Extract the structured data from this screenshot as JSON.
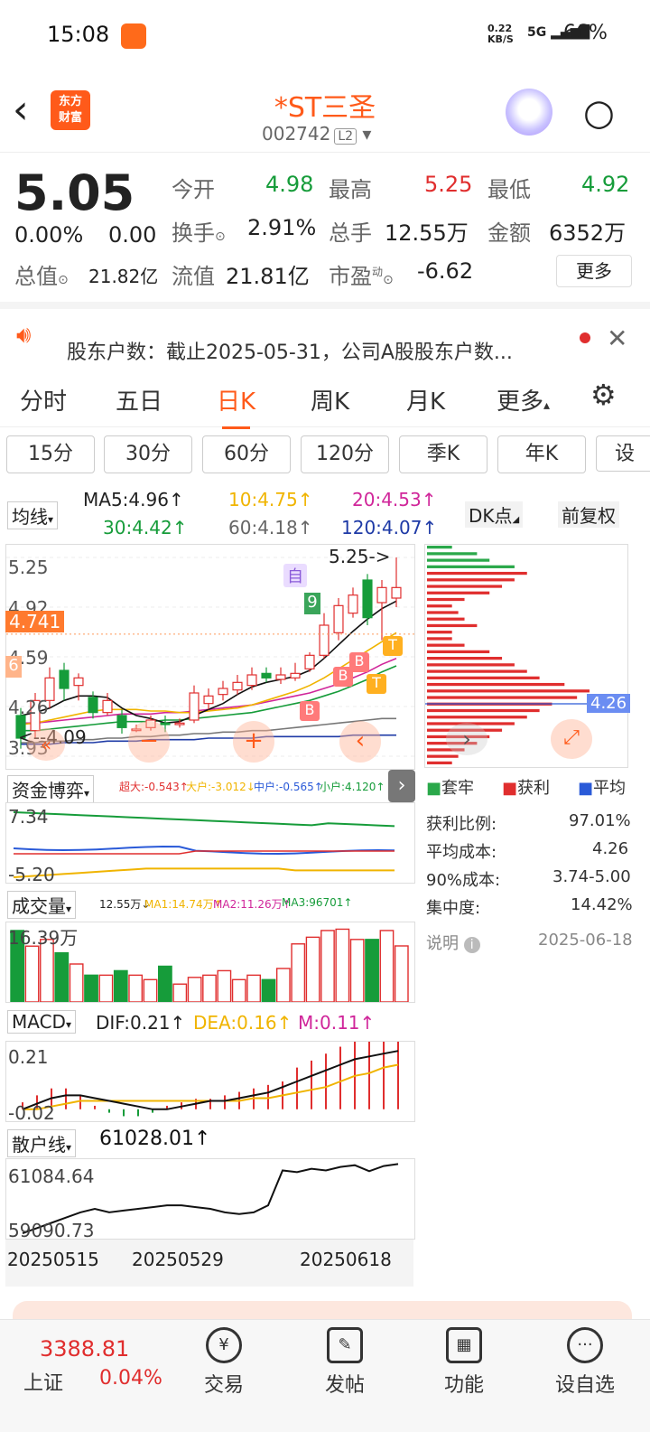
{
  "status": {
    "time": "15:08",
    "net": "0.22\nKB/S",
    "signal": "5G",
    "battery": "66%"
  },
  "header": {
    "brand": "东方\n财富",
    "title": "*ST三圣",
    "code": "002742",
    "level": "L2"
  },
  "quote": {
    "price": "5.05",
    "change_pct": "0.00%",
    "change": "0.00",
    "open_label": "今开",
    "open": "4.98",
    "high_label": "最高",
    "high": "5.25",
    "low_label": "最低",
    "low": "4.92",
    "turnover_label": "换手",
    "turnover": "2.91%",
    "volume_label": "总手",
    "volume": "12.55万",
    "amount_label": "金额",
    "amount": "6352万",
    "mktcap_label": "总值",
    "mktcap": "21.82亿",
    "float_label": "流值",
    "float": "21.81亿",
    "pe_label": "市盈",
    "pe_sup": "动",
    "pe": "-6.62",
    "more": "更多"
  },
  "notice": {
    "text": "股东户数：截止2025-05-31，公司A股股东户数..."
  },
  "tabs": [
    "分时",
    "五日",
    "日K",
    "周K",
    "月K",
    "更多"
  ],
  "subtabs": [
    "15分",
    "30分",
    "60分",
    "120分",
    "季K",
    "年K",
    "设"
  ],
  "ma": {
    "label": "均线",
    "ma5": "MA5:4.96",
    "ma10": "10:4.75",
    "ma20": "20:4.53",
    "ma30": "30:4.42",
    "ma60": "60:4.18",
    "ma120": "120:4.07",
    "dk": "DK点",
    "fq": "前复权"
  },
  "kchart": {
    "ymax": "5.25",
    "y2": "4.92",
    "ylast": "4.741",
    "y3": "4.59",
    "y4": "4.26",
    "ymin": "3.93",
    "high_marker": "5.25->",
    "low_marker": "<--4.09",
    "mark_self": "自",
    "mark_b": "B",
    "mark_t": "T",
    "mark_6": "6",
    "mark_9": "9"
  },
  "fund": {
    "label": "资金博弈",
    "super": "超大:-0.543",
    "big": "大户:-3.012",
    "mid": "中户:-0.565",
    "small": "小户:4.120",
    "ytop": "7.34",
    "ybot": "-5.20"
  },
  "vol": {
    "label": "成交量",
    "v": "12.55万",
    "ma1": "MA1:14.74万",
    "ma2": "MA2:11.26万",
    "ma3": "MA3:96701",
    "ytop": "16.39万"
  },
  "macd": {
    "label": "MACD",
    "dif": "DIF:0.21",
    "dea": "DEA:0.16",
    "m": "M:0.11",
    "ytop": "0.21",
    "ybot": "-0.02"
  },
  "sanhu": {
    "label": "散户线",
    "value": "61028.01",
    "ytop": "61084.64",
    "ybot": "59090.73"
  },
  "dates": [
    "20250515",
    "20250529",
    "20250618"
  ],
  "chip": {
    "legend_trapped": "套牢",
    "legend_profit": "获利",
    "legend_avg": "平均",
    "profit_ratio_label": "获利比例:",
    "profit_ratio": "97.01%",
    "avg_cost_label": "平均成本:",
    "avg_cost": "4.26",
    "cost90_label": "90%成本:",
    "cost90": "3.74-5.00",
    "conc_label": "集中度:",
    "conc": "14.42%",
    "explain": "说明",
    "date": "2025-06-18",
    "price_tag": "4.26"
  },
  "bottom": {
    "index_value": "3388.81",
    "index_name": "上证",
    "index_pct": "0.04%",
    "trade": "交易",
    "post": "发帖",
    "func": "功能",
    "custom": "设自选"
  },
  "chart_data": {
    "type": "candlestick",
    "title": "",
    "ylim": [
      3.93,
      5.25
    ],
    "candles": [
      {
        "o": 4.2,
        "c": 4.05,
        "h": 4.25,
        "l": 3.98
      },
      {
        "o": 4.1,
        "c": 4.3,
        "h": 4.35,
        "l": 4.05
      },
      {
        "o": 4.3,
        "c": 4.45,
        "h": 4.52,
        "l": 4.25
      },
      {
        "o": 4.5,
        "c": 4.38,
        "h": 4.55,
        "l": 4.3
      },
      {
        "o": 4.4,
        "c": 4.45,
        "h": 4.48,
        "l": 4.3
      },
      {
        "o": 4.32,
        "c": 4.22,
        "h": 4.36,
        "l": 4.18
      },
      {
        "o": 4.22,
        "c": 4.3,
        "h": 4.35,
        "l": 4.2
      },
      {
        "o": 4.2,
        "c": 4.12,
        "h": 4.24,
        "l": 4.08
      },
      {
        "o": 4.1,
        "c": 4.11,
        "h": 4.14,
        "l": 4.09
      },
      {
        "o": 4.12,
        "c": 4.17,
        "h": 4.2,
        "l": 4.1
      },
      {
        "o": 4.15,
        "c": 4.14,
        "h": 4.2,
        "l": 4.09
      },
      {
        "o": 4.14,
        "c": 4.15,
        "h": 4.18,
        "l": 4.12
      },
      {
        "o": 4.17,
        "c": 4.35,
        "h": 4.4,
        "l": 4.15
      },
      {
        "o": 4.28,
        "c": 4.33,
        "h": 4.38,
        "l": 4.24
      },
      {
        "o": 4.34,
        "c": 4.38,
        "h": 4.43,
        "l": 4.3
      },
      {
        "o": 4.37,
        "c": 4.42,
        "h": 4.47,
        "l": 4.34
      },
      {
        "o": 4.4,
        "c": 4.47,
        "h": 4.52,
        "l": 4.37
      },
      {
        "o": 4.48,
        "c": 4.45,
        "h": 4.52,
        "l": 4.42
      },
      {
        "o": 4.44,
        "c": 4.47,
        "h": 4.52,
        "l": 4.41
      },
      {
        "o": 4.45,
        "c": 4.48,
        "h": 4.55,
        "l": 4.43
      },
      {
        "o": 4.51,
        "c": 4.6,
        "h": 4.62,
        "l": 4.49
      },
      {
        "o": 4.6,
        "c": 4.8,
        "h": 4.88,
        "l": 4.58
      },
      {
        "o": 4.75,
        "c": 4.93,
        "h": 4.98,
        "l": 4.7
      },
      {
        "o": 4.88,
        "c": 5.0,
        "h": 5.05,
        "l": 4.85
      },
      {
        "o": 5.1,
        "c": 4.85,
        "h": 5.14,
        "l": 4.8
      },
      {
        "o": 4.95,
        "c": 5.05,
        "h": 5.1,
        "l": 4.7
      },
      {
        "o": 4.98,
        "c": 5.05,
        "h": 5.25,
        "l": 4.92
      }
    ],
    "ma5": [
      4.2,
      4.22,
      4.25,
      4.3,
      4.33,
      4.33,
      4.32,
      4.25,
      4.2,
      4.18,
      4.15,
      4.16,
      4.2,
      4.24,
      4.28,
      4.34,
      4.39,
      4.42,
      4.44,
      4.46,
      4.5,
      4.58,
      4.67,
      4.76,
      4.84,
      4.91,
      4.96
    ],
    "ma10": [
      4.14,
      4.15,
      4.17,
      4.19,
      4.21,
      4.23,
      4.24,
      4.24,
      4.24,
      4.23,
      4.23,
      4.22,
      4.22,
      4.23,
      4.24,
      4.25,
      4.27,
      4.3,
      4.33,
      4.36,
      4.4,
      4.45,
      4.51,
      4.57,
      4.63,
      4.69,
      4.75
    ],
    "ma20": [
      4.1,
      4.1,
      4.11,
      4.12,
      4.13,
      4.14,
      4.15,
      4.16,
      4.16,
      4.16,
      4.17,
      4.17,
      4.18,
      4.19,
      4.2,
      4.21,
      4.22,
      4.24,
      4.26,
      4.28,
      4.3,
      4.33,
      4.36,
      4.4,
      4.44,
      4.49,
      4.53
    ],
    "ma60": [
      4.02,
      4.02,
      4.03,
      4.03,
      4.04,
      4.04,
      4.05,
      4.05,
      4.06,
      4.06,
      4.07,
      4.07,
      4.08,
      4.08,
      4.09,
      4.09,
      4.1,
      4.1,
      4.11,
      4.12,
      4.13,
      4.14,
      4.15,
      4.16,
      4.17,
      4.18,
      4.18
    ],
    "ma120": [
      4.01,
      4.01,
      4.01,
      4.02,
      4.02,
      4.02,
      4.03,
      4.03,
      4.03,
      4.04,
      4.04,
      4.04,
      4.04,
      4.05,
      4.05,
      4.05,
      4.05,
      4.06,
      4.06,
      4.06,
      4.06,
      4.06,
      4.06,
      4.07,
      4.07,
      4.07,
      4.07
    ],
    "volume": [
      16.0,
      12.5,
      14.0,
      11.0,
      8.5,
      6.0,
      6.0,
      7.0,
      6.0,
      5.0,
      8.0,
      4.0,
      5.5,
      6.0,
      7.0,
      5.0,
      6.0,
      5.0,
      7.5,
      13.0,
      14.5,
      16.0,
      16.3,
      14.0,
      14.0,
      16.0,
      12.55
    ],
    "macd_hist": [
      0.01,
      0.02,
      0.03,
      0.03,
      0.02,
      0.005,
      -0.005,
      -0.01,
      -0.01,
      -0.005,
      0.005,
      0.01,
      0.015,
      0.015,
      0.02,
      0.025,
      0.03,
      0.035,
      0.04,
      0.06,
      0.07,
      0.08,
      0.09,
      0.1,
      0.1,
      0.11,
      0.11
    ],
    "macd_dif": [
      0.0,
      0.02,
      0.04,
      0.05,
      0.05,
      0.04,
      0.03,
      0.02,
      0.01,
      0.0,
      0.0,
      0.01,
      0.02,
      0.03,
      0.03,
      0.04,
      0.05,
      0.06,
      0.08,
      0.1,
      0.12,
      0.14,
      0.16,
      0.18,
      0.19,
      0.2,
      0.21
    ],
    "macd_dea": [
      0.0,
      0.0,
      0.01,
      0.02,
      0.03,
      0.03,
      0.03,
      0.03,
      0.03,
      0.03,
      0.03,
      0.03,
      0.03,
      0.03,
      0.03,
      0.03,
      0.04,
      0.04,
      0.05,
      0.06,
      0.07,
      0.08,
      0.1,
      0.12,
      0.13,
      0.15,
      0.16
    ],
    "sanhu": [
      59100,
      59250,
      59400,
      59550,
      59700,
      59800,
      59700,
      59750,
      59800,
      59850,
      59900,
      59900,
      59850,
      59800,
      59700,
      59650,
      59700,
      59900,
      60900,
      60850,
      60950,
      60900,
      61000,
      61050,
      60880,
      61028.01,
      61084
    ],
    "chip_rows": [
      4,
      8,
      10,
      14,
      16,
      14,
      12,
      10,
      6,
      4,
      5,
      6,
      8,
      4,
      4,
      6,
      10,
      12,
      14,
      16,
      18,
      22,
      26,
      24,
      20,
      18,
      16,
      14,
      12,
      10,
      8,
      6,
      5,
      4
    ]
  }
}
